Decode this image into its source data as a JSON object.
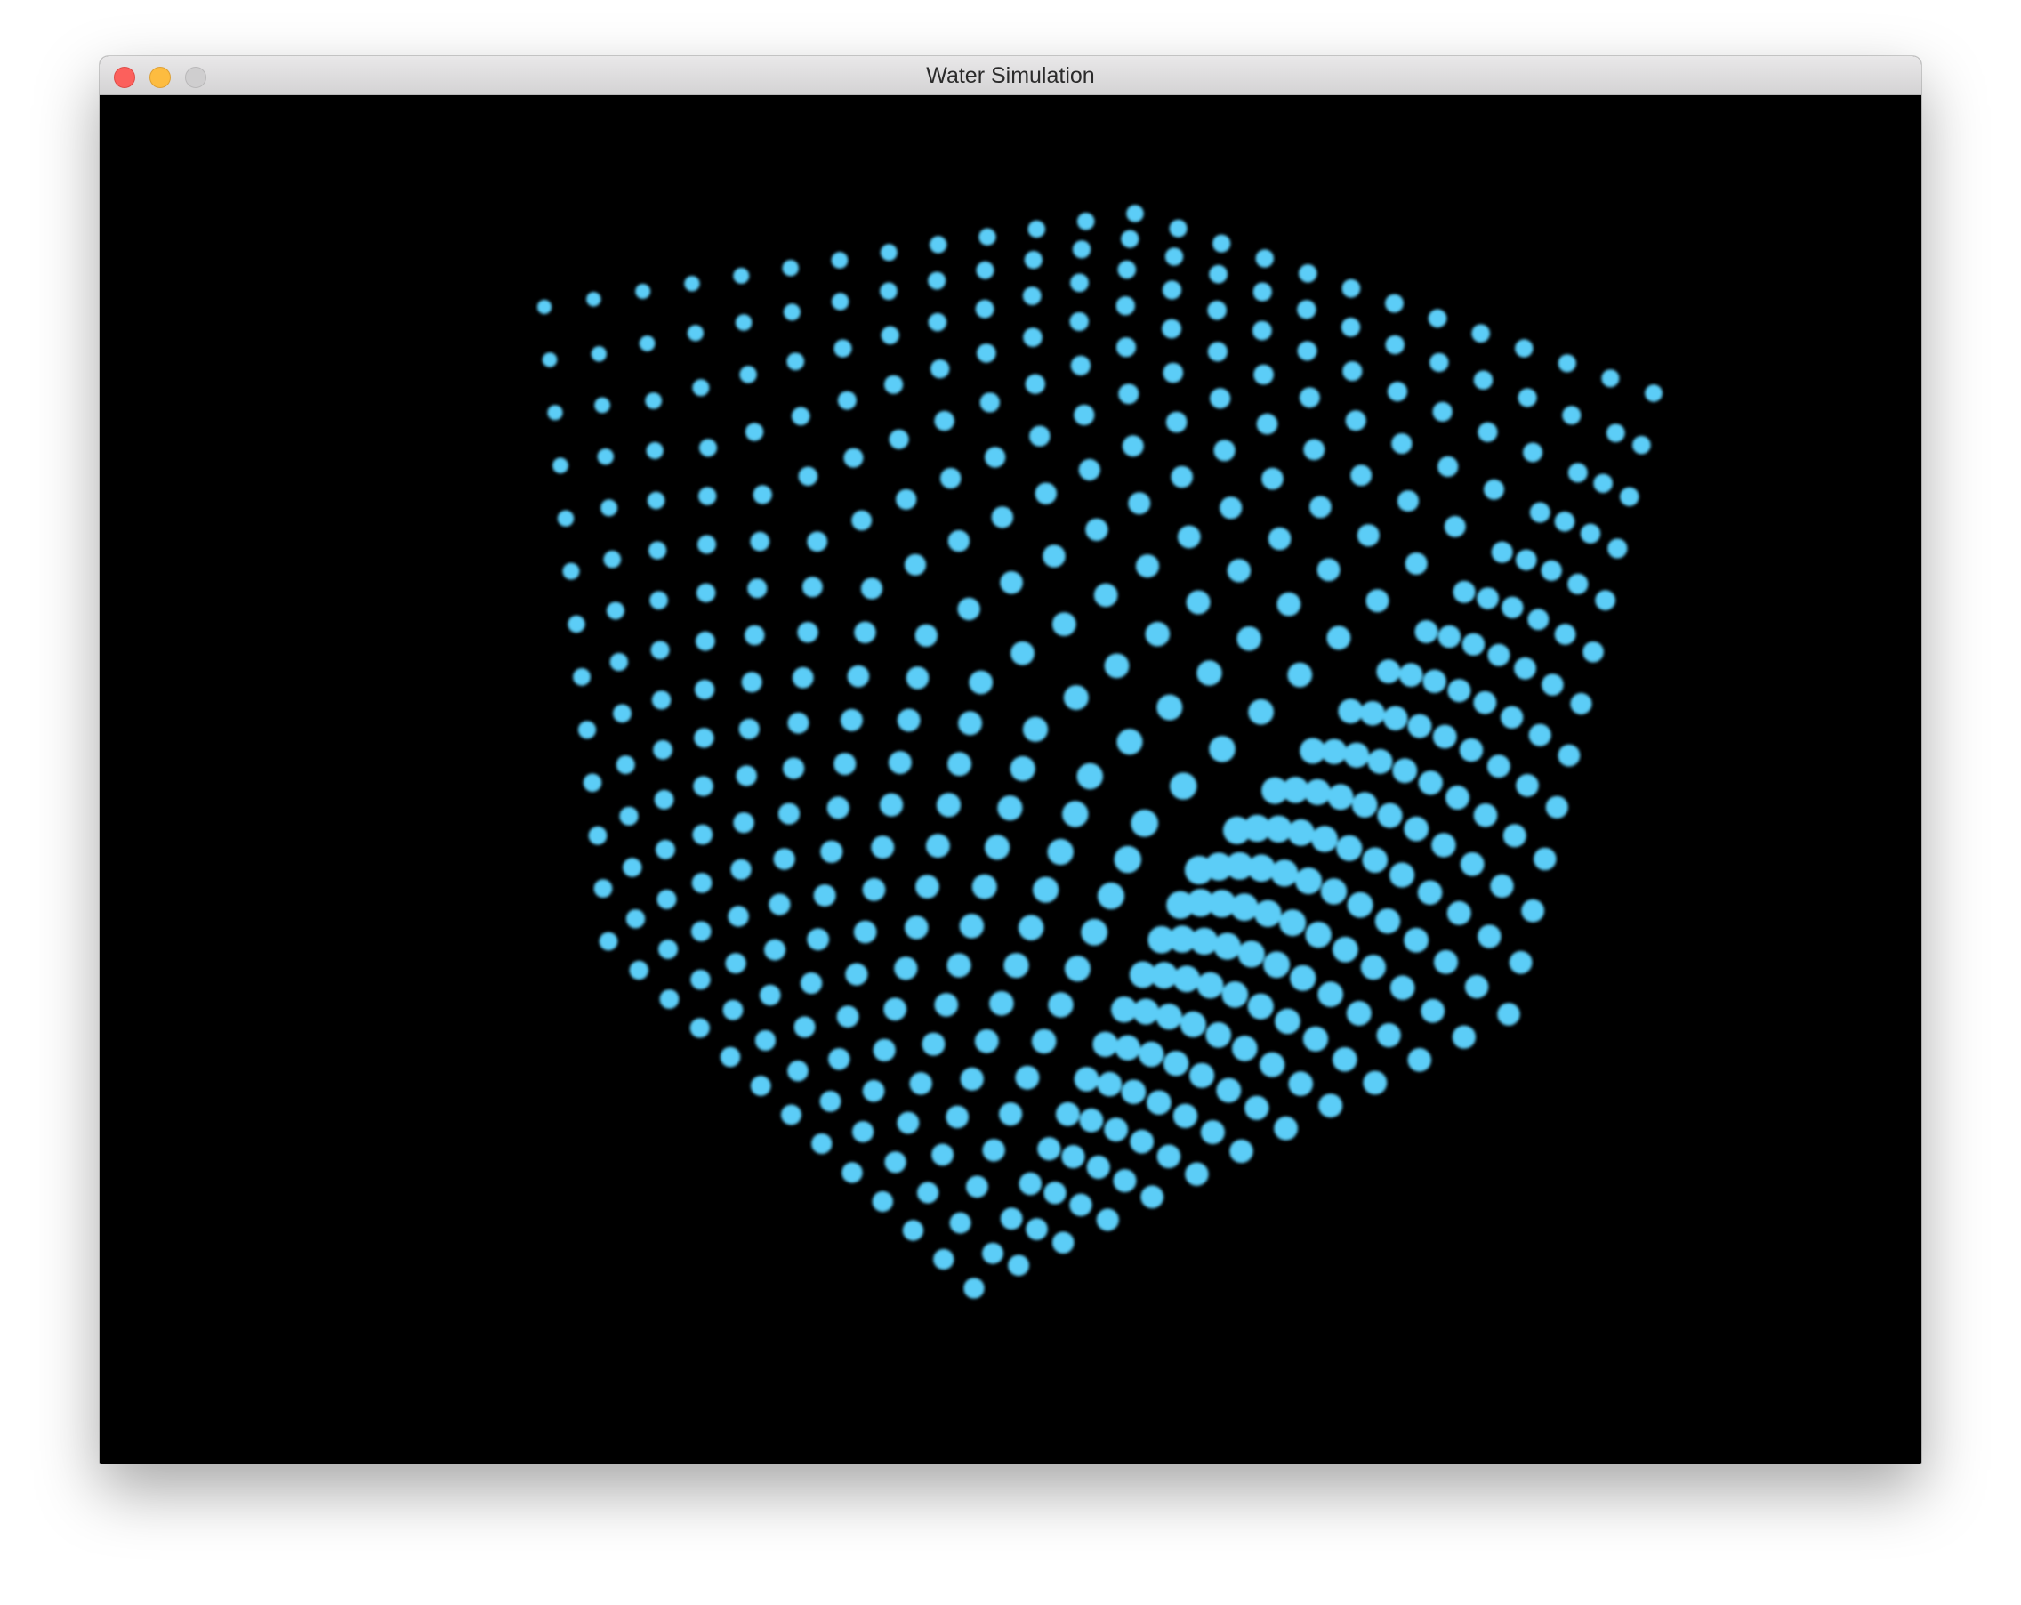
{
  "window": {
    "title": "Water Simulation"
  },
  "colors": {
    "background": "#000000",
    "particle": "#5ccdf7",
    "close": "#fc605c",
    "minimize": "#fdbc40",
    "zoom": "#cfcecf"
  },
  "icons": {
    "close": "close-icon",
    "minimize": "minimize-icon",
    "zoom": "zoom-icon"
  }
}
